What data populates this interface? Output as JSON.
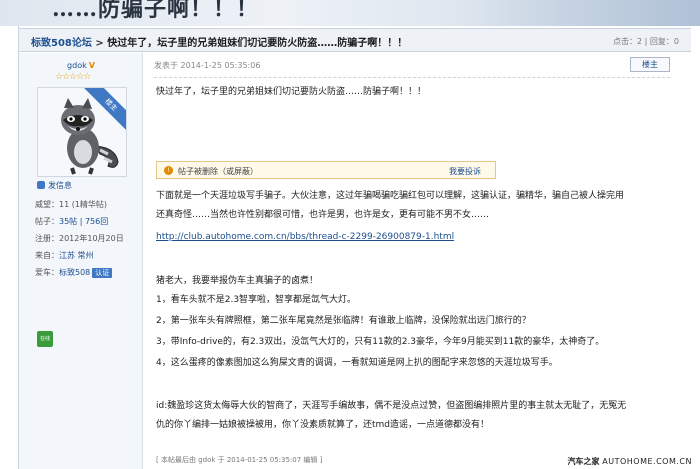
{
  "banner": {
    "text": "……防骗子啊！！！"
  },
  "thread": {
    "forum_link": "标致508论坛",
    "separator": ">",
    "title": "快过年了，坛子里的兄弟姐妹们切记要防火防盗……防骗子啊！！！",
    "stats": "点击：2 | 回复：0"
  },
  "author": {
    "name": "gdok",
    "v_badge": "V",
    "stars": "☆☆☆☆☆",
    "avatar_ribbon": "楼主",
    "message_link": "发信息",
    "fields": [
      {
        "label": "威望：",
        "value": "11 (1精华帖)"
      },
      {
        "label": "帖子：",
        "value": "35帖 | 756回"
      },
      {
        "label": "注册：",
        "value": "2012年10月20日"
      },
      {
        "label": "来自：",
        "value": "江苏 常州"
      },
      {
        "label": "爱车：",
        "value": "标致508"
      }
    ],
    "cert_badge": "认证",
    "online_label": "在线"
  },
  "post": {
    "posted_at": "发表于 2014-1-25 05:35:06",
    "floor_button": "楼主",
    "subtitle": "快过年了，坛子里的兄弟姐妹们切记要防火防盗……防骗子啊！！！",
    "notice": {
      "text": "帖子被删除（或屏蔽）",
      "report": "我要投诉"
    },
    "lines": [
      "下面就是一个天涯垃圾写手骗子。大伙注意，这过年骗喝骗吃骗红包可以理解，这骗认证，骗精华，骗自己被人操完用",
      "还真奇怪……当然也许性别都很可惜，也许是男，也许是女，更有可能不男不女……",
      "http://club.autohome.com.cn/bbs/thread-c-2299-26900879-1.html",
      "猪老大，我要举报伪车主真骗子的卤煮！",
      "1，看车头就不是2.3智享啦，智享都是氙气大灯。",
      "2，第一张车头有牌照框，第二张车尾竟然是张临牌！有谁敢上临牌，没保险就出远门旅行的？",
      "3，带Info-drive的，有2.3双出，没氙气大灯的，只有11款的2.3豪华，今年9月能买到11款的豪华，太神奇了。",
      "4，这么蛋疼的像素图加这么狗屎文青的调调，一看就知道是网上扒的图配字来忽悠的天涯垃圾写手。",
      "id:魏盈珍这货太侮辱大伙的智商了，天涯写手编故事，偶不是没点过赞，但盗图编排照片里的事主就太无耻了，无冤无",
      "仇的你丫编排一姑娘被操被用，你丫没素质就算了，还tmd造谣，一点道德都没有！"
    ],
    "edited": "[ 本帖最后由 gdok 于 2014-01-25 05:35:07 编辑 ]"
  },
  "watermark": {
    "cn": "汽车之家",
    "en": "AUTOHOME.COM.CN"
  },
  "colors": {
    "link": "#1c4f8f",
    "header_bg": "#eef2f7",
    "sidebar_bg": "#f3f6fa",
    "badge": "#3f79c4",
    "notice_bg": "#fff9ea"
  }
}
